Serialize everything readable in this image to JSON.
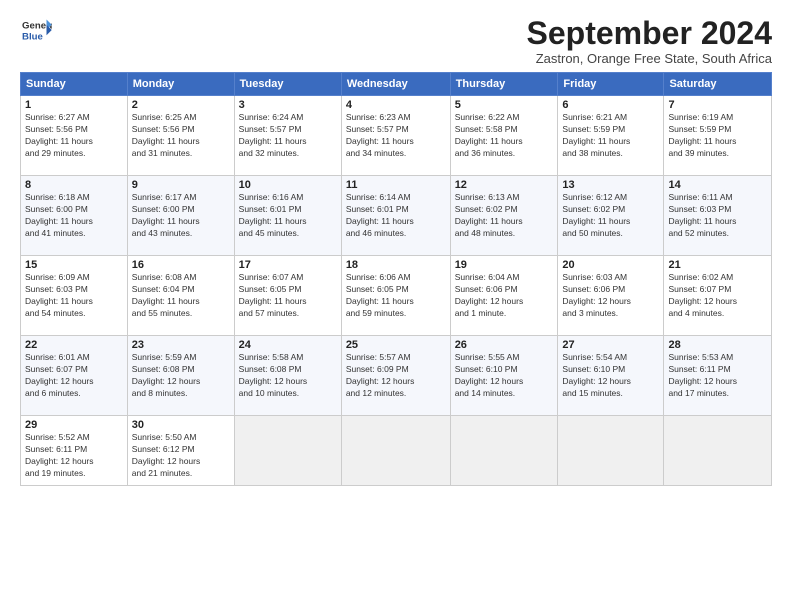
{
  "logo": {
    "line1": "General",
    "line2": "Blue"
  },
  "title": "September 2024",
  "subtitle": "Zastron, Orange Free State, South Africa",
  "headers": [
    "Sunday",
    "Monday",
    "Tuesday",
    "Wednesday",
    "Thursday",
    "Friday",
    "Saturday"
  ],
  "weeks": [
    [
      {
        "day": "1",
        "info": "Sunrise: 6:27 AM\nSunset: 5:56 PM\nDaylight: 11 hours\nand 29 minutes."
      },
      {
        "day": "2",
        "info": "Sunrise: 6:25 AM\nSunset: 5:56 PM\nDaylight: 11 hours\nand 31 minutes."
      },
      {
        "day": "3",
        "info": "Sunrise: 6:24 AM\nSunset: 5:57 PM\nDaylight: 11 hours\nand 32 minutes."
      },
      {
        "day": "4",
        "info": "Sunrise: 6:23 AM\nSunset: 5:57 PM\nDaylight: 11 hours\nand 34 minutes."
      },
      {
        "day": "5",
        "info": "Sunrise: 6:22 AM\nSunset: 5:58 PM\nDaylight: 11 hours\nand 36 minutes."
      },
      {
        "day": "6",
        "info": "Sunrise: 6:21 AM\nSunset: 5:59 PM\nDaylight: 11 hours\nand 38 minutes."
      },
      {
        "day": "7",
        "info": "Sunrise: 6:19 AM\nSunset: 5:59 PM\nDaylight: 11 hours\nand 39 minutes."
      }
    ],
    [
      {
        "day": "8",
        "info": "Sunrise: 6:18 AM\nSunset: 6:00 PM\nDaylight: 11 hours\nand 41 minutes."
      },
      {
        "day": "9",
        "info": "Sunrise: 6:17 AM\nSunset: 6:00 PM\nDaylight: 11 hours\nand 43 minutes."
      },
      {
        "day": "10",
        "info": "Sunrise: 6:16 AM\nSunset: 6:01 PM\nDaylight: 11 hours\nand 45 minutes."
      },
      {
        "day": "11",
        "info": "Sunrise: 6:14 AM\nSunset: 6:01 PM\nDaylight: 11 hours\nand 46 minutes."
      },
      {
        "day": "12",
        "info": "Sunrise: 6:13 AM\nSunset: 6:02 PM\nDaylight: 11 hours\nand 48 minutes."
      },
      {
        "day": "13",
        "info": "Sunrise: 6:12 AM\nSunset: 6:02 PM\nDaylight: 11 hours\nand 50 minutes."
      },
      {
        "day": "14",
        "info": "Sunrise: 6:11 AM\nSunset: 6:03 PM\nDaylight: 11 hours\nand 52 minutes."
      }
    ],
    [
      {
        "day": "15",
        "info": "Sunrise: 6:09 AM\nSunset: 6:03 PM\nDaylight: 11 hours\nand 54 minutes."
      },
      {
        "day": "16",
        "info": "Sunrise: 6:08 AM\nSunset: 6:04 PM\nDaylight: 11 hours\nand 55 minutes."
      },
      {
        "day": "17",
        "info": "Sunrise: 6:07 AM\nSunset: 6:05 PM\nDaylight: 11 hours\nand 57 minutes."
      },
      {
        "day": "18",
        "info": "Sunrise: 6:06 AM\nSunset: 6:05 PM\nDaylight: 11 hours\nand 59 minutes."
      },
      {
        "day": "19",
        "info": "Sunrise: 6:04 AM\nSunset: 6:06 PM\nDaylight: 12 hours\nand 1 minute."
      },
      {
        "day": "20",
        "info": "Sunrise: 6:03 AM\nSunset: 6:06 PM\nDaylight: 12 hours\nand 3 minutes."
      },
      {
        "day": "21",
        "info": "Sunrise: 6:02 AM\nSunset: 6:07 PM\nDaylight: 12 hours\nand 4 minutes."
      }
    ],
    [
      {
        "day": "22",
        "info": "Sunrise: 6:01 AM\nSunset: 6:07 PM\nDaylight: 12 hours\nand 6 minutes."
      },
      {
        "day": "23",
        "info": "Sunrise: 5:59 AM\nSunset: 6:08 PM\nDaylight: 12 hours\nand 8 minutes."
      },
      {
        "day": "24",
        "info": "Sunrise: 5:58 AM\nSunset: 6:08 PM\nDaylight: 12 hours\nand 10 minutes."
      },
      {
        "day": "25",
        "info": "Sunrise: 5:57 AM\nSunset: 6:09 PM\nDaylight: 12 hours\nand 12 minutes."
      },
      {
        "day": "26",
        "info": "Sunrise: 5:55 AM\nSunset: 6:10 PM\nDaylight: 12 hours\nand 14 minutes."
      },
      {
        "day": "27",
        "info": "Sunrise: 5:54 AM\nSunset: 6:10 PM\nDaylight: 12 hours\nand 15 minutes."
      },
      {
        "day": "28",
        "info": "Sunrise: 5:53 AM\nSunset: 6:11 PM\nDaylight: 12 hours\nand 17 minutes."
      }
    ],
    [
      {
        "day": "29",
        "info": "Sunrise: 5:52 AM\nSunset: 6:11 PM\nDaylight: 12 hours\nand 19 minutes."
      },
      {
        "day": "30",
        "info": "Sunrise: 5:50 AM\nSunset: 6:12 PM\nDaylight: 12 hours\nand 21 minutes."
      },
      {
        "day": "",
        "info": ""
      },
      {
        "day": "",
        "info": ""
      },
      {
        "day": "",
        "info": ""
      },
      {
        "day": "",
        "info": ""
      },
      {
        "day": "",
        "info": ""
      }
    ]
  ]
}
